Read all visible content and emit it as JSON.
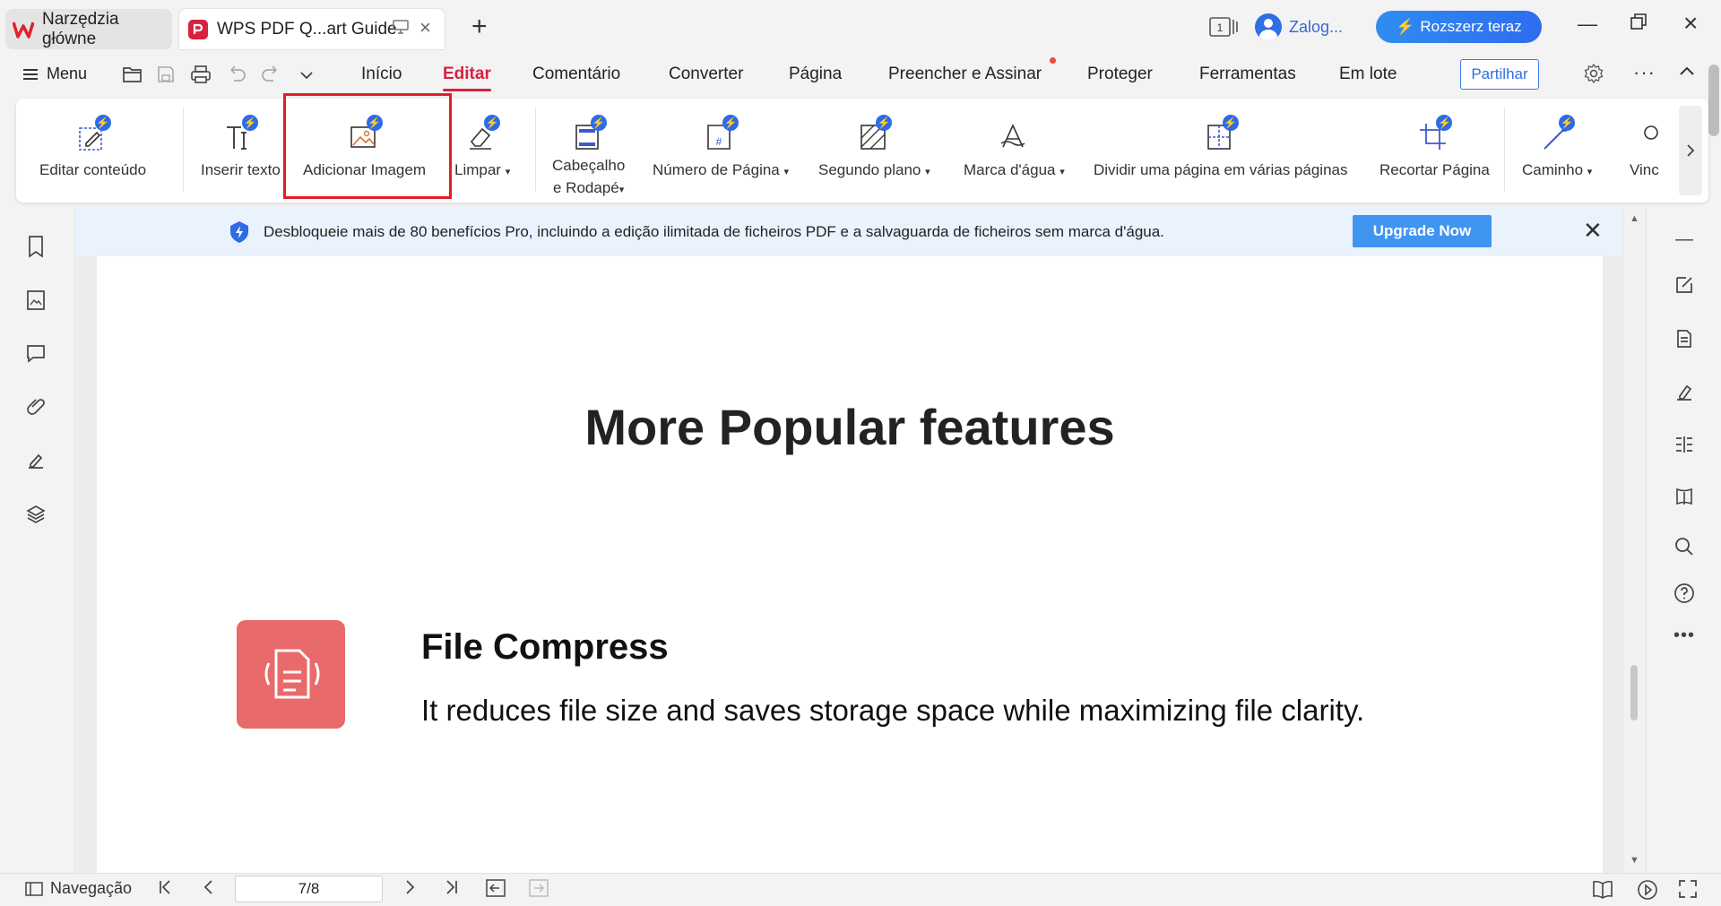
{
  "tabs": [
    {
      "label": "Narzędzia główne"
    },
    {
      "label": "WPS PDF Q...art Guide"
    }
  ],
  "titlebar": {
    "page_indicator": "1",
    "user_label": "Zalog...",
    "upgrade_label": "Rozszerz teraz"
  },
  "menu": {
    "menu_label": "Menu",
    "tabs": [
      "Início",
      "Editar",
      "Comentário",
      "Converter",
      "Página",
      "Preencher e Assinar",
      "Proteger",
      "Ferramentas",
      "Em lote"
    ],
    "active_tab": "Editar",
    "share_label": "Partilhar"
  },
  "ribbon": {
    "items": [
      {
        "label": "Editar conteúdo",
        "icon": "edit-content-icon"
      },
      {
        "label": "Inserir texto",
        "icon": "insert-text-icon"
      },
      {
        "label": "Adicionar Imagem",
        "icon": "add-image-icon"
      },
      {
        "label": "Limpar",
        "icon": "eraser-icon"
      },
      {
        "label": "Cabeçalho",
        "label2": "e Rodapé",
        "icon": "header-footer-icon"
      },
      {
        "label": "Número de Página",
        "icon": "page-number-icon"
      },
      {
        "label": "Segundo plano",
        "icon": "background-icon"
      },
      {
        "label": "Marca d'água",
        "icon": "watermark-icon"
      },
      {
        "label": "Dividir uma página em várias páginas",
        "icon": "split-page-icon"
      },
      {
        "label": "Recortar Página",
        "icon": "crop-page-icon"
      },
      {
        "label": "Caminho",
        "icon": "path-icon"
      },
      {
        "label": "Vinc",
        "icon": "link-icon"
      }
    ]
  },
  "notice": {
    "text": "Desbloqueie mais de 80 benefícios Pro, incluindo a edição ilimitada de ficheiros PDF e a salvaguarda de ficheiros sem marca d'água.",
    "button": "Upgrade Now"
  },
  "document": {
    "heading": "More Popular features",
    "feature_title": "File Compress",
    "feature_desc": "It reduces file size and saves storage space while maximizing file clarity."
  },
  "statusbar": {
    "nav_label": "Navegação",
    "page_value": "7/8"
  },
  "colors": {
    "accent": "#d6213f",
    "brand_blue": "#2e6be6",
    "feature_icon": "#e96a6a",
    "highlight": "#e31e24"
  }
}
